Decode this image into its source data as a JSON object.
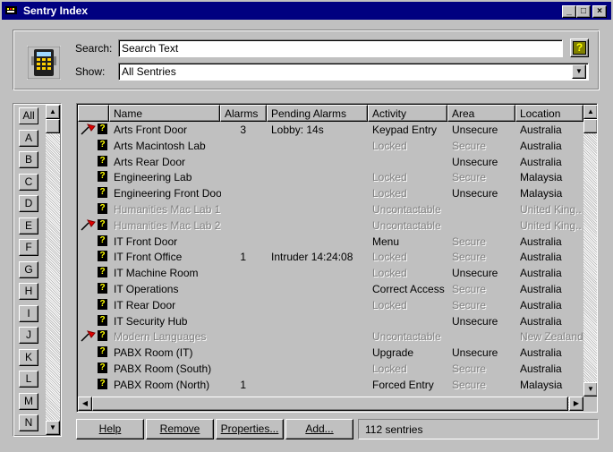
{
  "window": {
    "title": "Sentry Index",
    "controls": {
      "minimize": "_",
      "maximize": "□",
      "close": "×"
    }
  },
  "search": {
    "label": "Search:",
    "value": "Search Text",
    "help_icon": "help-icon",
    "help_glyph": "?"
  },
  "show": {
    "label": "Show:",
    "value": "All Sentries"
  },
  "letters": [
    "All",
    "A",
    "B",
    "C",
    "D",
    "E",
    "F",
    "G",
    "H",
    "I",
    "J",
    "K",
    "L",
    "M",
    "N"
  ],
  "columns": [
    "Name",
    "Alarms",
    "Pending Alarms",
    "Activity",
    "Area",
    "Location"
  ],
  "rows": [
    {
      "name": "Arts Front Door",
      "alarms": "3",
      "pending": "Lobby: 14s",
      "activity": "Keypad Entry",
      "area": "Unsecure",
      "location": "Australia",
      "alarm_flag": true,
      "dim_name": false,
      "dim_activity": false,
      "dim_area": false,
      "dim_location": false
    },
    {
      "name": "Arts Macintosh Lab",
      "alarms": "",
      "pending": "",
      "activity": "Locked",
      "area": "Secure",
      "location": "Australia",
      "alarm_flag": false,
      "dim_name": false,
      "dim_activity": true,
      "dim_area": true,
      "dim_location": false
    },
    {
      "name": "Arts Rear Door",
      "alarms": "",
      "pending": "",
      "activity": "",
      "area": "Unsecure",
      "location": "Australia",
      "alarm_flag": false,
      "dim_name": false,
      "dim_activity": false,
      "dim_area": false,
      "dim_location": false
    },
    {
      "name": "Engineering Lab",
      "alarms": "",
      "pending": "",
      "activity": "Locked",
      "area": "Secure",
      "location": "Malaysia",
      "alarm_flag": false,
      "dim_name": false,
      "dim_activity": true,
      "dim_area": true,
      "dim_location": false
    },
    {
      "name": "Engineering Front Door",
      "alarms": "",
      "pending": "",
      "activity": "Locked",
      "area": "Unsecure",
      "location": "Malaysia",
      "alarm_flag": false,
      "dim_name": false,
      "dim_activity": true,
      "dim_area": false,
      "dim_location": false
    },
    {
      "name": "Humanities Mac Lab 1",
      "alarms": "",
      "pending": "",
      "activity": "Uncontactable",
      "area": "",
      "location": "United King...",
      "alarm_flag": false,
      "dim_name": true,
      "dim_activity": true,
      "dim_area": true,
      "dim_location": true
    },
    {
      "name": "Humanities Mac Lab 2",
      "alarms": "",
      "pending": "",
      "activity": "Uncontactable",
      "area": "",
      "location": "United King...",
      "alarm_flag": true,
      "dim_name": true,
      "dim_activity": true,
      "dim_area": true,
      "dim_location": true
    },
    {
      "name": "IT Front Door",
      "alarms": "",
      "pending": "",
      "activity": "Menu",
      "area": "Secure",
      "location": "Australia",
      "alarm_flag": false,
      "dim_name": false,
      "dim_activity": false,
      "dim_area": true,
      "dim_location": false
    },
    {
      "name": "IT Front Office",
      "alarms": "1",
      "pending": "Intruder 14:24:08",
      "activity": "Locked",
      "area": "Secure",
      "location": "Australia",
      "alarm_flag": false,
      "dim_name": false,
      "dim_activity": true,
      "dim_area": true,
      "dim_location": false
    },
    {
      "name": "IT Machine Room",
      "alarms": "",
      "pending": "",
      "activity": "Locked",
      "area": "Unsecure",
      "location": "Australia",
      "alarm_flag": false,
      "dim_name": false,
      "dim_activity": true,
      "dim_area": false,
      "dim_location": false
    },
    {
      "name": "IT Operations",
      "alarms": "",
      "pending": "",
      "activity": "Correct Access",
      "area": "Secure",
      "location": "Australia",
      "alarm_flag": false,
      "dim_name": false,
      "dim_activity": false,
      "dim_area": true,
      "dim_location": false
    },
    {
      "name": "IT Rear Door",
      "alarms": "",
      "pending": "",
      "activity": "Locked",
      "area": "Secure",
      "location": "Australia",
      "alarm_flag": false,
      "dim_name": false,
      "dim_activity": true,
      "dim_area": true,
      "dim_location": false
    },
    {
      "name": "IT Security Hub",
      "alarms": "",
      "pending": "",
      "activity": "",
      "area": "Unsecure",
      "location": "Australia",
      "alarm_flag": false,
      "dim_name": false,
      "dim_activity": false,
      "dim_area": false,
      "dim_location": false
    },
    {
      "name": "Modern Languages",
      "alarms": "",
      "pending": "",
      "activity": "Uncontactable",
      "area": "",
      "location": "New Zealand",
      "alarm_flag": true,
      "dim_name": true,
      "dim_activity": true,
      "dim_area": true,
      "dim_location": true
    },
    {
      "name": "PABX Room (IT)",
      "alarms": "",
      "pending": "",
      "activity": "Upgrade",
      "area": "Unsecure",
      "location": "Australia",
      "alarm_flag": false,
      "dim_name": false,
      "dim_activity": false,
      "dim_area": false,
      "dim_location": false
    },
    {
      "name": "PABX Room (South)",
      "alarms": "",
      "pending": "",
      "activity": "Locked",
      "area": "Secure",
      "location": "Australia",
      "alarm_flag": false,
      "dim_name": false,
      "dim_activity": true,
      "dim_area": true,
      "dim_location": false
    },
    {
      "name": "PABX Room (North)",
      "alarms": "1",
      "pending": "",
      "activity": "Forced Entry",
      "area": "Secure",
      "location": "Malaysia",
      "alarm_flag": false,
      "dim_name": false,
      "dim_activity": false,
      "dim_area": true,
      "dim_location": false
    }
  ],
  "buttons": {
    "help": "Help",
    "remove": "Remove",
    "properties": "Properties...",
    "add": "Add..."
  },
  "status": {
    "count_text": "112 sentries"
  },
  "icons": {
    "sentry_device": "keypad-device-icon",
    "row_status": "question-icon",
    "row_alarm": "alarm-flag-icon"
  },
  "colors": {
    "titlebar": "#000080",
    "face": "#c0c0c0",
    "help_button": "#808000",
    "help_glyph": "#ffff00"
  }
}
